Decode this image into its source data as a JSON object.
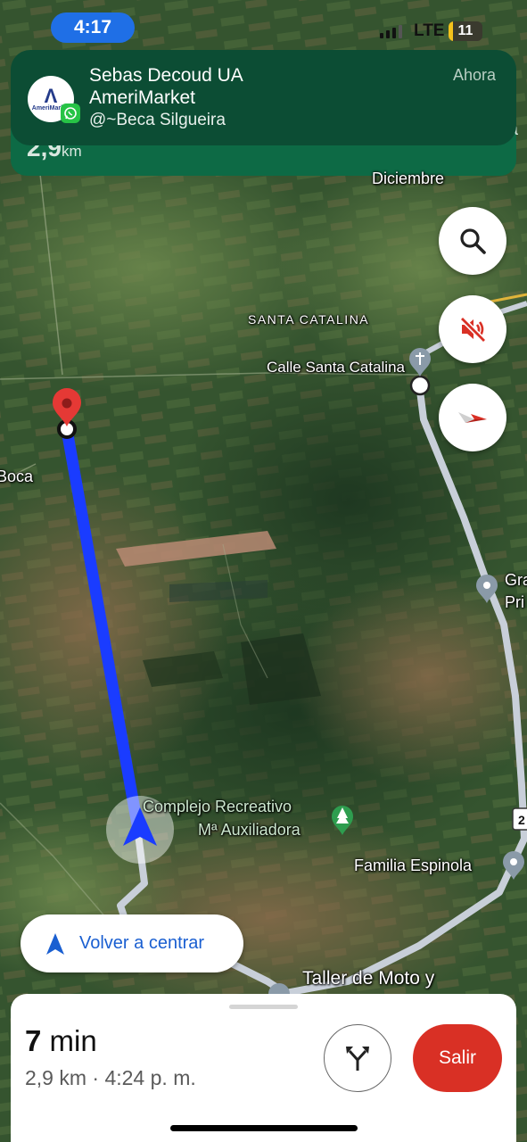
{
  "status_bar": {
    "time": "4:17",
    "network": "LTE",
    "battery": "11"
  },
  "nav_banner": {
    "distance_value": "2,9",
    "distance_unit": "km",
    "street_edge_text": "a"
  },
  "notification": {
    "title_line1": "Sebas Decoud UA",
    "title_line2": "AmeriMarket",
    "subtitle": "@~Beca Silgueira",
    "time": "Ahora",
    "avatar_logo_text": "AmeriMarket",
    "app_icon": "whatsapp-icon"
  },
  "map": {
    "labels": {
      "diciembre": "Diciembre",
      "santa_catalina": "SANTA CATALINA",
      "calle_santa_catalina": "Calle Santa Catalina",
      "boca": "Boca",
      "gra": "Gra",
      "pri": "Pri",
      "complejo_line1": "Complejo Recreativo",
      "complejo_line2": "Mª Auxiliadora",
      "familia_espinola": "Familia Espinola",
      "taller": "Taller de Moto y",
      "road_shield": "2"
    },
    "buttons": {
      "search": "search-icon",
      "mute": "volume-off-icon",
      "compass": "compass-icon"
    },
    "colors": {
      "route": "#1a3cff",
      "road": "#c8cfd9",
      "destination_pin": "#e53935"
    }
  },
  "recenter": {
    "label": "Volver a centrar"
  },
  "bottom_sheet": {
    "eta_value": "7",
    "eta_unit": "min",
    "trip_info": "2,9 km · 4:24 p. m.",
    "alt_routes_icon": "alt-route-icon",
    "exit_label": "Salir"
  }
}
